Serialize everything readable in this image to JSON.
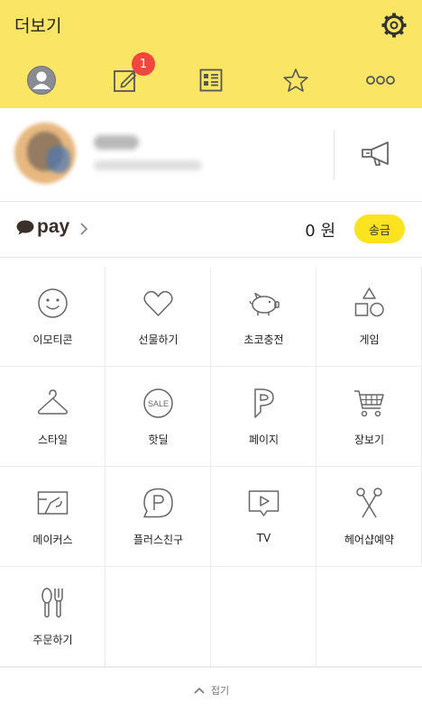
{
  "header": {
    "title": "더보기",
    "tabs": [
      {
        "icon": "profile-icon"
      },
      {
        "icon": "edit-icon",
        "badge": "1"
      },
      {
        "icon": "list-icon"
      },
      {
        "icon": "star-icon"
      },
      {
        "icon": "more-icon"
      }
    ]
  },
  "pay": {
    "logo_text": "pay",
    "amount": "0 원",
    "send_label": "송금"
  },
  "grid": [
    {
      "label": "이모티콘",
      "icon": "emoticon-icon"
    },
    {
      "label": "선물하기",
      "icon": "heart-icon"
    },
    {
      "label": "초코충전",
      "icon": "piggy-bank-icon"
    },
    {
      "label": "게임",
      "icon": "shapes-icon"
    },
    {
      "label": "스타일",
      "icon": "hanger-icon"
    },
    {
      "label": "핫딜",
      "icon": "sale-icon"
    },
    {
      "label": "페이지",
      "icon": "page-p-icon"
    },
    {
      "label": "장보기",
      "icon": "cart-icon"
    },
    {
      "label": "메이커스",
      "icon": "makers-icon"
    },
    {
      "label": "플러스친구",
      "icon": "plus-friend-icon"
    },
    {
      "label": "TV",
      "icon": "tv-icon"
    },
    {
      "label": "헤어샵예약",
      "icon": "scissors-icon"
    },
    {
      "label": "주문하기",
      "icon": "cutlery-icon"
    }
  ],
  "footer": {
    "collapse_label": "접기"
  }
}
